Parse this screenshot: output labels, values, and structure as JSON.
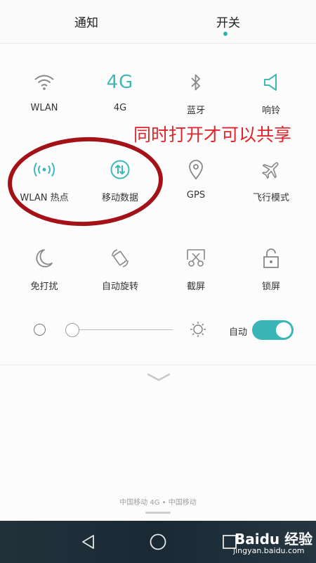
{
  "tabs": [
    {
      "label": "通知"
    },
    {
      "label": "开关",
      "active": true
    }
  ],
  "toggles": [
    {
      "icon": "wifi-icon",
      "label": "WLAN"
    },
    {
      "icon": "4g-icon",
      "icon_text": "4G",
      "label": "4G"
    },
    {
      "icon": "bluetooth-icon",
      "label": "蓝牙"
    },
    {
      "icon": "speaker-icon",
      "label": "响铃"
    },
    {
      "icon": "hotspot-icon",
      "label": "WLAN 热点"
    },
    {
      "icon": "mobile-data-icon",
      "label": "移动数据"
    },
    {
      "icon": "location-pin-icon",
      "label": "GPS"
    },
    {
      "icon": "airplane-icon",
      "label": "飞行模式"
    },
    {
      "icon": "moon-icon",
      "label": "免打扰"
    },
    {
      "icon": "auto-rotate-icon",
      "label": "自动旋转"
    },
    {
      "icon": "screenshot-icon",
      "label": "截屏"
    },
    {
      "icon": "unlock-icon",
      "label": "锁屏"
    }
  ],
  "annotation": {
    "text": "同时打开才可以共享",
    "color": "#e3242b"
  },
  "brightness": {
    "level": 0.0,
    "auto_label": "自动",
    "auto_on": true
  },
  "carrier": {
    "text": "中国移动 4G • 中国移动"
  },
  "watermark": {
    "logo": "Baidu 经验",
    "sub": "jingyan.baidu.com"
  },
  "colors": {
    "accent": "#3bb6b6",
    "annotation_oval": "#a41218",
    "navbar": "#22303a"
  }
}
